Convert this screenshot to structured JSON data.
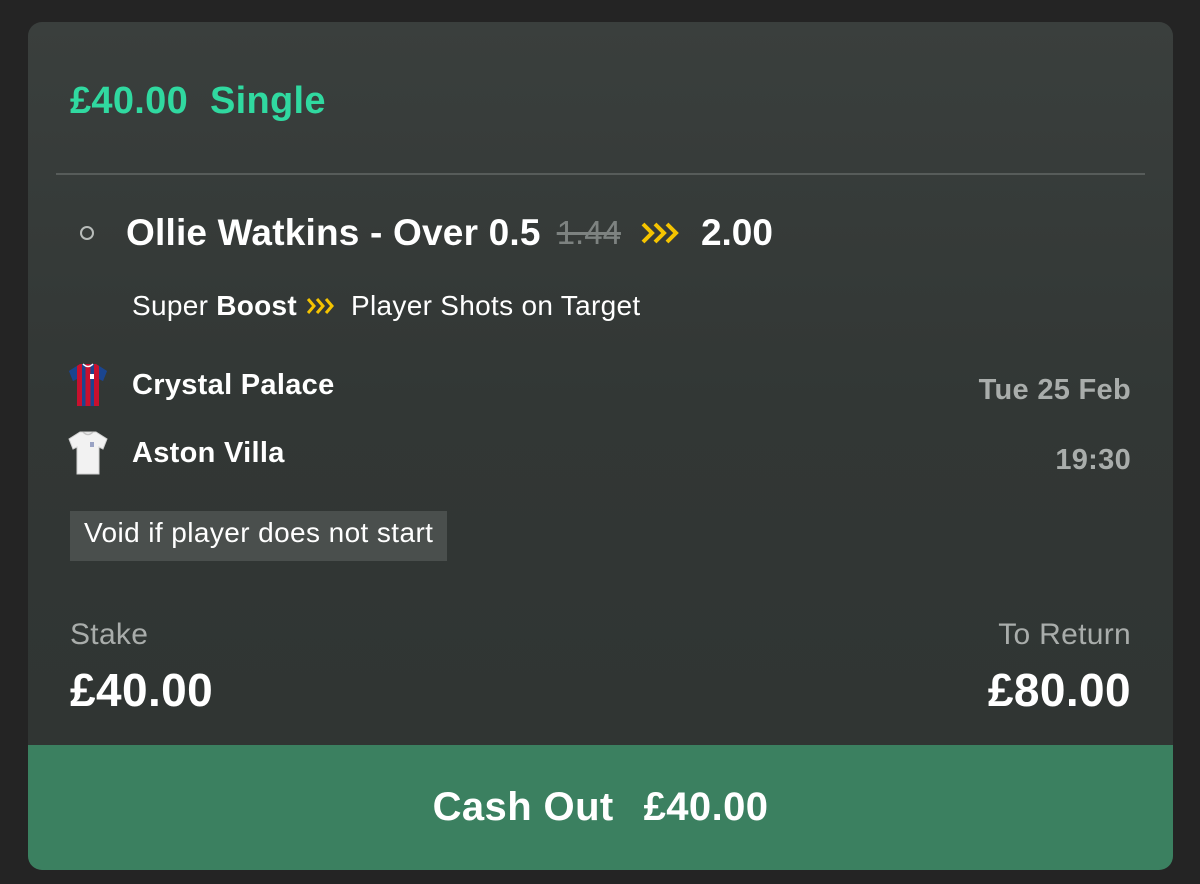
{
  "bet": {
    "amount": "£40.00",
    "type": "Single"
  },
  "selection": {
    "name": "Ollie Watkins - Over 0.5",
    "old_odds": "1.44",
    "new_odds": "2.00",
    "boost_prefix": "Super",
    "boost_word": "Boost",
    "market": "Player Shots on Target"
  },
  "event": {
    "home_team": "Crystal Palace",
    "away_team": "Aston Villa",
    "date": "Tue 25 Feb",
    "time": "19:30"
  },
  "note": "Void if player does not start",
  "stake": {
    "label": "Stake",
    "value": "£40.00"
  },
  "to_return": {
    "label": "To Return",
    "value": "£80.00"
  },
  "cash_out": {
    "label": "Cash Out",
    "amount": "£40.00"
  },
  "colors": {
    "accent_green": "#30d9a0",
    "boost_yellow": "#f5c400",
    "cashout_bg": "#3b8060",
    "palace_red": "#c8102e",
    "palace_blue": "#1b458f"
  },
  "icons": {
    "radio": "radio-unselected-icon",
    "boost": "boost-chevrons-icon",
    "home_kit": "crystal-palace-shirt-icon",
    "away_kit": "aston-villa-shirt-icon"
  }
}
